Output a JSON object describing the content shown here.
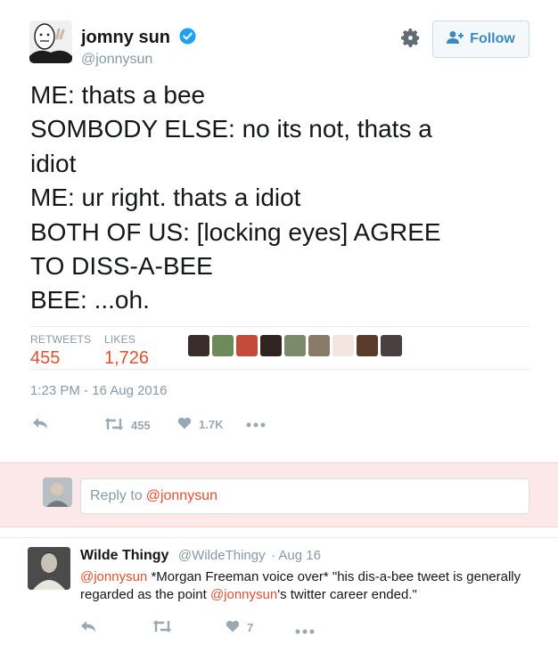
{
  "tweet": {
    "display_name": "jomny sun",
    "handle": "@jonnysun",
    "follow_label": "Follow",
    "text_lines": [
      "ME: thats a bee",
      "SOMBODY ELSE: no its not, thats a",
      "idiot",
      "ME: ur right. thats a idiot",
      "BOTH OF US: [locking eyes] AGREE",
      "TO DISS-A-BEE",
      "BEE: ...oh."
    ],
    "stats": {
      "retweets_label": "RETWEETS",
      "retweets_value": "455",
      "likes_label": "LIKES",
      "likes_value": "1,726"
    },
    "timestamp": "1:23 PM - 16 Aug 2016",
    "actions": {
      "retweet_count": "455",
      "like_count": "1.7K"
    }
  },
  "reply_box": {
    "placeholder_prefix": "Reply to",
    "placeholder_mention": "@jonnysun"
  },
  "reply_tweet": {
    "display_name": "Wilde Thingy",
    "handle": "@WildeThingy",
    "date": "· Aug 16",
    "mention_1": "@jonnysun",
    "text_1": " *Morgan Freeman voice over* \"his dis-a-bee tweet is generally regarded as the point ",
    "mention_2": "@jonnysun",
    "text_2": "'s twitter career ended.\"",
    "like_count": "7"
  },
  "colors": {
    "accent": "#e0502e",
    "verified_blue": "#1da1f2",
    "muted": "#8899a6",
    "reply_band": "#fce8e8"
  },
  "icons": [
    "verified-icon",
    "gear-icon",
    "follow-user-icon",
    "reply-icon",
    "retweet-icon",
    "heart-icon",
    "more-icon"
  ]
}
